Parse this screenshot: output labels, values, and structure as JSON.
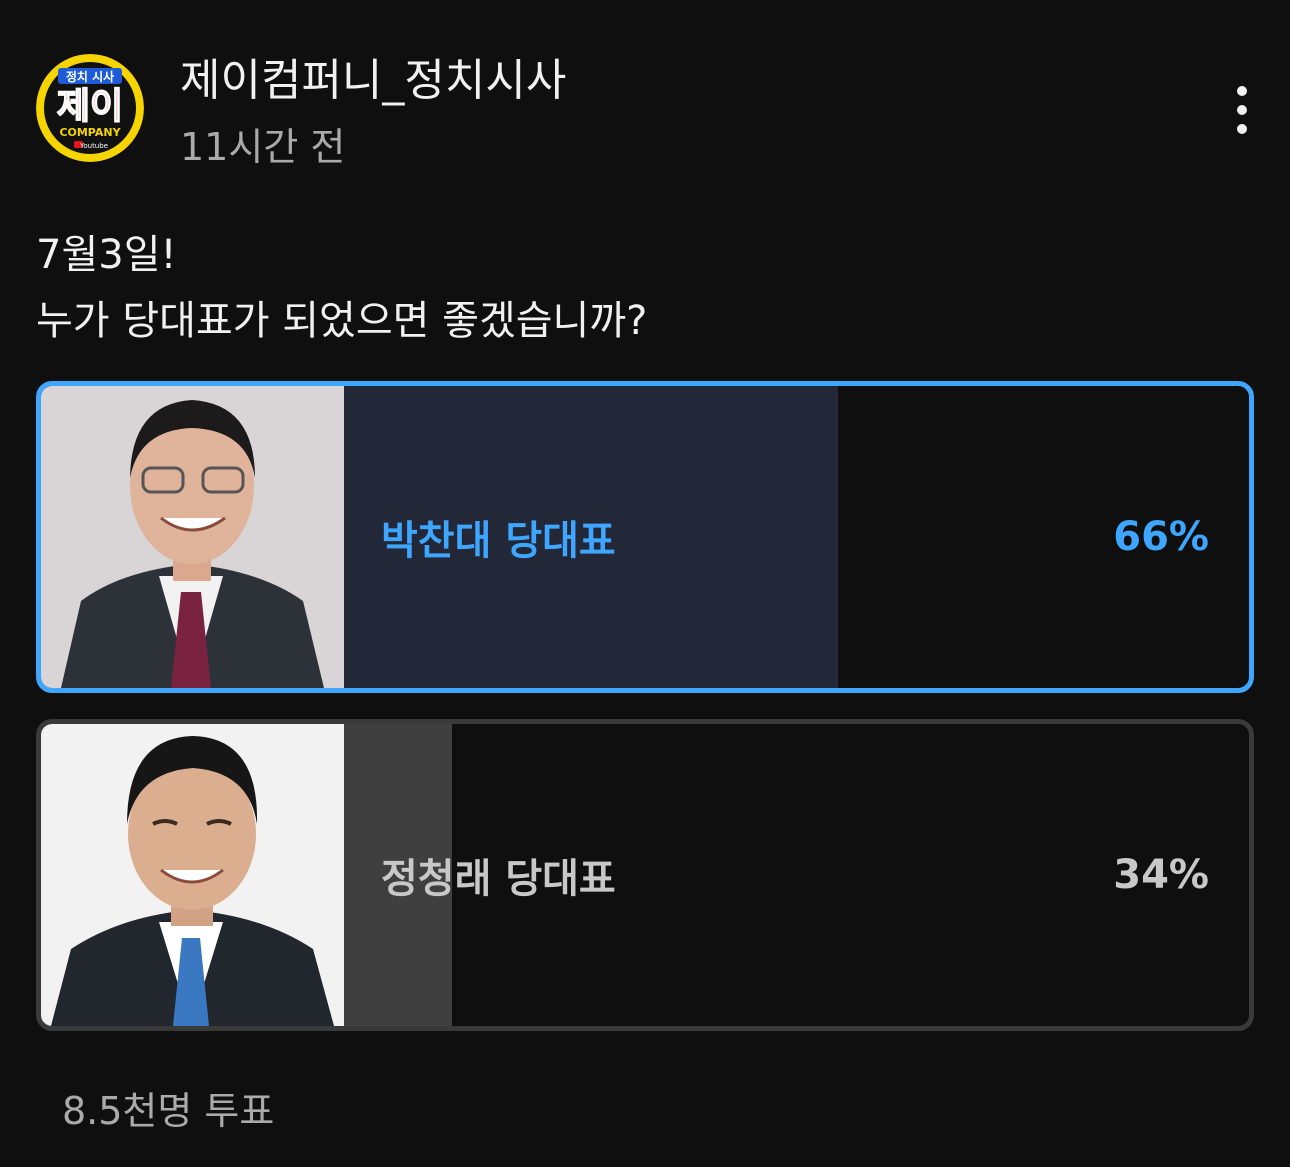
{
  "header": {
    "channel_name": "제이컴퍼니_정치시사",
    "timestamp": "11시간 전",
    "avatar": {
      "top_text": "정치 시사",
      "main_text": "제이",
      "sub_text": "COMPANY",
      "badge_text": "Youtube",
      "ring_color": "#f5d400",
      "main_color": "#e8141b"
    }
  },
  "post": {
    "lines": [
      "7월3일!",
      "누가 당대표가 되었으면 좋겠습니까?"
    ]
  },
  "poll": {
    "options": [
      {
        "label": "박찬대 당대표",
        "percent": "66%",
        "fraction": 0.66,
        "selected": true
      },
      {
        "label": "정청래 당대표",
        "percent": "34%",
        "fraction": 0.34,
        "selected": false
      }
    ],
    "vote_count": "8.5천명 투표"
  },
  "colors": {
    "accent": "#3ea6ff",
    "background": "#0f0f0f",
    "selected_fill": "#232838",
    "unselected_fill": "#3f3f3f"
  }
}
